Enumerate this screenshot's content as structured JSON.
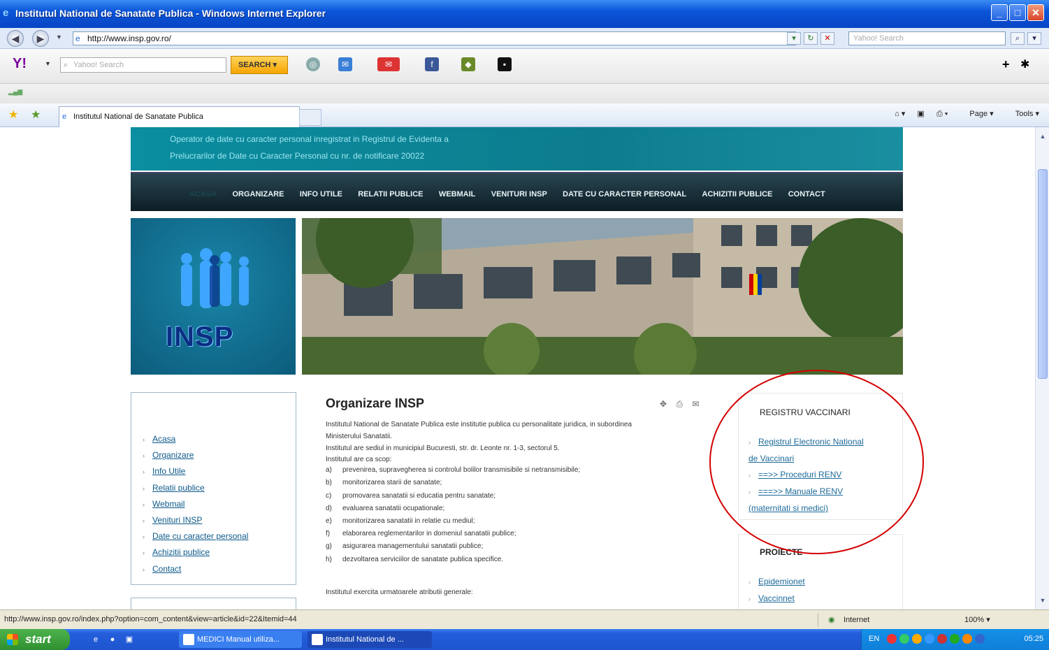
{
  "window": {
    "title": "Institutul National de Sanatate Publica - Windows Internet Explorer",
    "controls": [
      "_",
      "□",
      "✕"
    ]
  },
  "address": {
    "url": "http://www.insp.gov.ro/",
    "search_placeholder": "Yahoo! Search"
  },
  "yahoo_toolbar": {
    "logo": "Y!",
    "search_placeholder": "Yahoo! Search",
    "search_button": "SEARCH"
  },
  "tabs": [
    {
      "label": "Institutul National de Sanatate Publica"
    }
  ],
  "command_bar": {
    "page": "Page",
    "tools": "Tools"
  },
  "site": {
    "banner_lines": [
      "Operator de date cu caracter personal inregistrat in Registrul de Evidenta a",
      "Prelucrarilor de Date cu Caracter Personal cu nr. de notificare 20022"
    ],
    "nav": [
      {
        "label": "ACASA"
      },
      {
        "label": "ORGANIZARE"
      },
      {
        "label": "INFO UTILE"
      },
      {
        "label": "RELATII PUBLICE"
      },
      {
        "label": "WEBMAIL"
      },
      {
        "label": "VENITURI INSP"
      },
      {
        "label": "DATE CU CARACTER PERSONAL"
      },
      {
        "label": "ACHIZITII PUBLICE"
      },
      {
        "label": "CONTACT"
      }
    ],
    "logo_text": "INSP",
    "left_menu": [
      {
        "label": "Acasa"
      },
      {
        "label": "Organizare"
      },
      {
        "label": "Info Utile"
      },
      {
        "label": "Relatii publice"
      },
      {
        "label": "Webmail"
      },
      {
        "label": "Venituri INSP"
      },
      {
        "label": "Date cu caracter personal"
      },
      {
        "label": "Achizitii publice"
      },
      {
        "label": "Contact"
      }
    ],
    "article": {
      "title": "Organizare INSP",
      "para1": "Institutul National de Sanatate Publica este institutie publica cu personalitate juridica, in subordinea",
      "para1b": "Ministerului Sanatatii.",
      "para2": "Institutul are sediul in municipiul Bucuresti, str. dr. Leonte nr. 1-3, sectorul 5.",
      "para3": "Institutul are ca scop:",
      "items": [
        {
          "letter": "a)",
          "text": "prevenirea, supravegherea si controlul bolilor transmisibile si netransmisibile;"
        },
        {
          "letter": "b)",
          "text": "monitorizarea starii de sanatate;"
        },
        {
          "letter": "c)",
          "text": "promovarea sanatatii si educatia pentru sanatate;"
        },
        {
          "letter": "d)",
          "text": "evaluarea sanatatii ocupationale;"
        },
        {
          "letter": "e)",
          "text": "monitorizarea sanatatii in relatie cu mediul;"
        },
        {
          "letter": "f)",
          "text": "elaborarea reglementarilor in domeniul sanatatii publice;"
        },
        {
          "letter": "g)",
          "text": "asigurarea managementului sanatatii publice;"
        },
        {
          "letter": "h)",
          "text": "dezvoltarea serviciilor de sanatate publica specifice."
        }
      ],
      "last_line": "Institutul exercita urmatoarele atributii generale:"
    },
    "right_box_1": {
      "title": "REGISTRU VACCINARI",
      "links": [
        {
          "l1": "Registrul Electronic National",
          "l2": "de Vaccinari"
        },
        {
          "l1": "==>> Proceduri RENV",
          "l2": ""
        },
        {
          "l1": "===>> Manuale RENV",
          "l2": "(maternitati si medici)"
        }
      ]
    },
    "right_box_2": {
      "title": "PROIECTE",
      "links": [
        {
          "label": "Epidemionet"
        },
        {
          "label": "Vaccinnet"
        }
      ]
    }
  },
  "status": {
    "url": "http://www.insp.gov.ro/index.php?option=com_content&view=article&id=22&Itemid=44",
    "zone": "Internet",
    "zoom": "100%"
  },
  "taskbar": {
    "start": "start",
    "buttons": [
      {
        "label": "MEDICI Manual utiliza..."
      },
      {
        "label": "Institutul National de ..."
      }
    ],
    "language": "EN",
    "clock": "05:25"
  },
  "colors": {
    "accent_teal": "#0d7d8e",
    "link_blue": "#1d6a9a",
    "annotation_red": "#d40000"
  }
}
